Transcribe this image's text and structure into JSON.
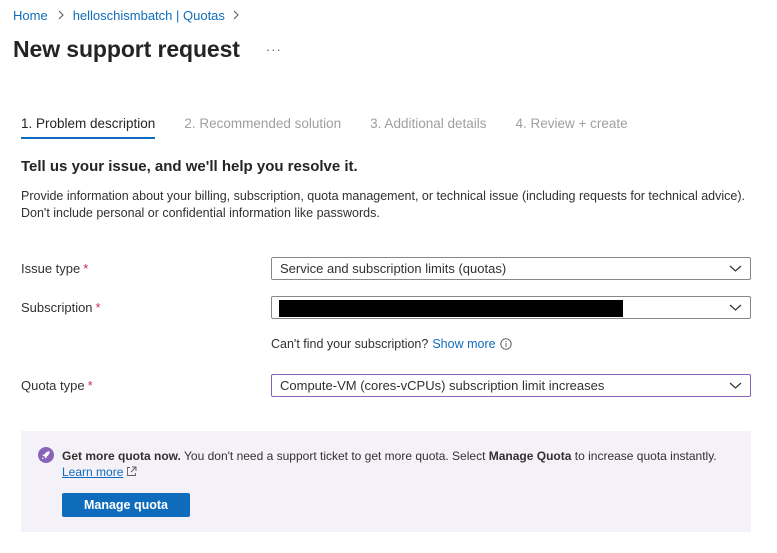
{
  "breadcrumb": {
    "items": [
      "Home",
      "helloschismbatch | Quotas"
    ]
  },
  "header": {
    "title": "New support request",
    "more": "···"
  },
  "tabs": [
    {
      "label": "1. Problem description",
      "active": true
    },
    {
      "label": "2. Recommended solution",
      "active": false
    },
    {
      "label": "3. Additional details",
      "active": false
    },
    {
      "label": "4. Review + create",
      "active": false
    }
  ],
  "section": {
    "heading": "Tell us your issue, and we'll help you resolve it.",
    "description": "Provide information about your billing, subscription, quota management, or technical issue (including requests for technical advice). Don't include personal or confidential information like passwords."
  },
  "form": {
    "issue_type": {
      "label": "Issue type",
      "required": "*",
      "value": "Service and subscription limits (quotas)"
    },
    "subscription": {
      "label": "Subscription",
      "required": "*",
      "value": ""
    },
    "subscription_hint": {
      "text": "Can't find your subscription?",
      "link": "Show more"
    },
    "quota_type": {
      "label": "Quota type",
      "required": "*",
      "value": "Compute-VM (cores-vCPUs) subscription limit increases"
    }
  },
  "banner": {
    "bold_lead": "Get more quota now.",
    "text_before": " You don't need a support ticket to get more quota. Select ",
    "bold_inline": "Manage Quota",
    "text_after": " to increase quota instantly.",
    "learn_more": "Learn more",
    "button": "Manage quota"
  },
  "colors": {
    "link": "#0f6cbd",
    "accent": "#0f6cbd",
    "required": "#c4314b",
    "banner_bg": "#f4f1f8",
    "focus_border": "#8764b8",
    "rocket": "#8764b8"
  },
  "icons": [
    "chevron-right-icon",
    "more-icon",
    "chevron-down-icon",
    "info-icon",
    "rocket-icon",
    "external-link-icon"
  ]
}
